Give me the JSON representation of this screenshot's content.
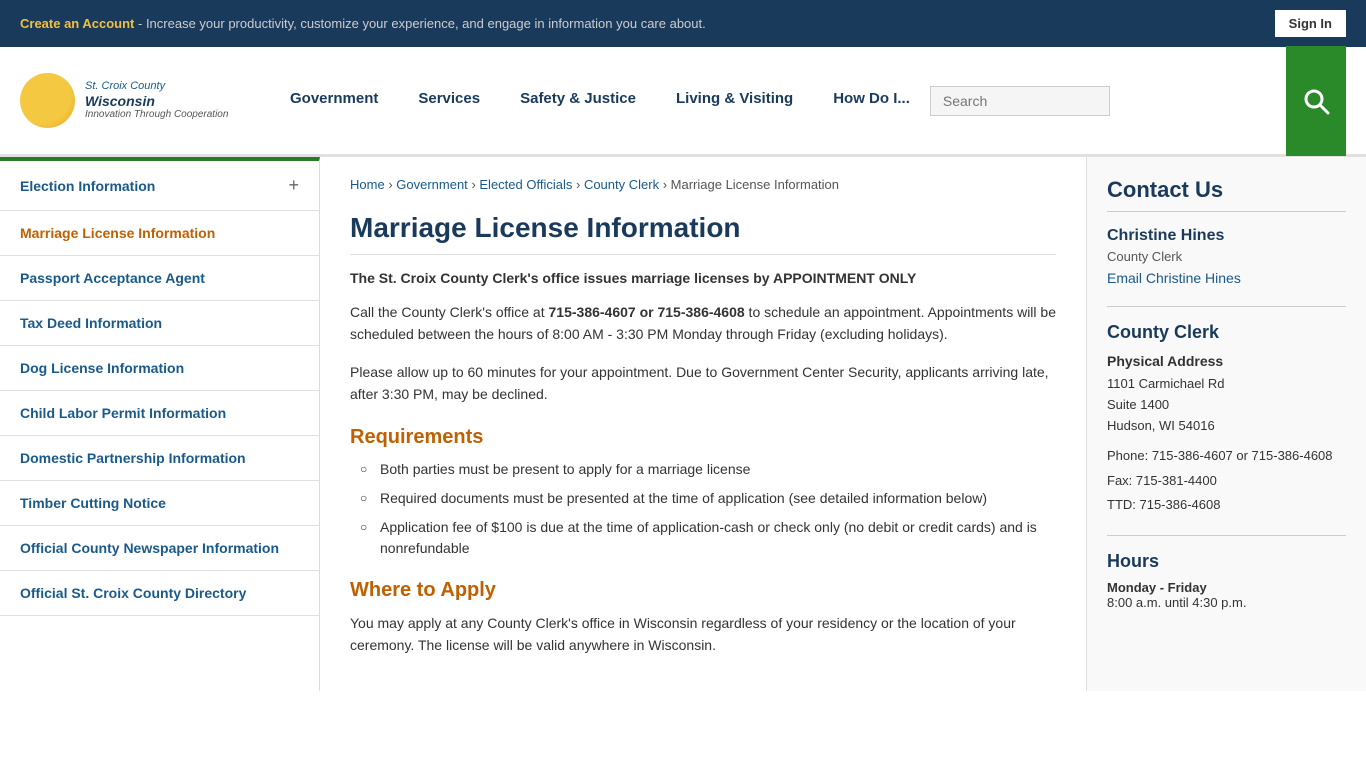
{
  "topBanner": {
    "createAccountText": "Create an Account",
    "bannerMessage": " - Increase your productivity, customize your experience, and engage in information you care about.",
    "signInLabel": "Sign In"
  },
  "header": {
    "logoLine1": "St. Croix County",
    "logoLine2": "Wisconsin",
    "logoTagline": "Innovation Through Cooperation",
    "navItems": [
      {
        "label": "Government",
        "id": "nav-government"
      },
      {
        "label": "Services",
        "id": "nav-services"
      },
      {
        "label": "Safety & Justice",
        "id": "nav-safety"
      },
      {
        "label": "Living & Visiting",
        "id": "nav-living"
      },
      {
        "label": "How Do I...",
        "id": "nav-howdo"
      }
    ],
    "searchPlaceholder": "Search"
  },
  "sidebar": {
    "items": [
      {
        "label": "Election Information",
        "hasPlus": true
      },
      {
        "label": "Marriage License Information",
        "hasPlus": false,
        "active": true
      },
      {
        "label": "Passport Acceptance Agent",
        "hasPlus": false
      },
      {
        "label": "Tax Deed Information",
        "hasPlus": false
      },
      {
        "label": "Dog License Information",
        "hasPlus": false
      },
      {
        "label": "Child Labor Permit Information",
        "hasPlus": false
      },
      {
        "label": "Domestic Partnership Information",
        "hasPlus": false
      },
      {
        "label": "Timber Cutting Notice",
        "hasPlus": false
      },
      {
        "label": "Official County Newspaper Information",
        "hasPlus": false
      },
      {
        "label": "Official St. Croix County Directory",
        "hasPlus": false
      }
    ]
  },
  "breadcrumb": {
    "home": "Home",
    "government": "Government",
    "electedOfficials": "Elected Officials",
    "countyClerk": "County Clerk",
    "current": "Marriage License Information"
  },
  "mainContent": {
    "pageTitle": "Marriage License Information",
    "introText": "The St. Croix County Clerk's office issues marriage licenses by APPOINTMENT ONLY",
    "bodyParagraph1": "Call the County Clerk's office at 715-386-4607 or 715-386-4608 to schedule an appointment. Appointments will be scheduled between the hours of 8:00 AM - 3:30 PM Monday through Friday (excluding holidays).",
    "bodyParagraph2": "Please allow up to 60 minutes for your appointment.  Due to Government Center Security, applicants arriving late, after 3:30 PM, may be declined.",
    "requirementsHeading": "Requirements",
    "requirements": [
      "Both parties must be present to apply for a marriage license",
      "Required documents must be presented at the time of application (see detailed information below)",
      "Application fee of $100 is due at the time of application-cash or check only (no debit or credit cards) and is nonrefundable"
    ],
    "whereToApplyHeading": "Where to Apply",
    "whereToApplyText": "You may apply at any County Clerk's office in Wisconsin regardless of your residency or the location of your ceremony. The license will be valid anywhere in Wisconsin."
  },
  "rightSidebar": {
    "contactUsTitle": "Contact Us",
    "contactName": "Christine Hines",
    "contactRole": "County Clerk",
    "emailLabel": "Email Christine Hines",
    "countyClerkTitle": "County Clerk",
    "physicalAddressLabel": "Physical Address",
    "addressLine1": "1101 Carmichael Rd",
    "addressLine2": "Suite 1400",
    "addressLine3": "Hudson, WI 54016",
    "phone": "Phone: 715-386-4607 or 715-386-4608",
    "fax": "Fax: 715-381-4400",
    "ttd": "TTD: 715-386-4608",
    "hoursTitle": "Hours",
    "hoursDay": "Monday - Friday",
    "hoursTime": "8:00 a.m. until 4:30 p.m."
  }
}
